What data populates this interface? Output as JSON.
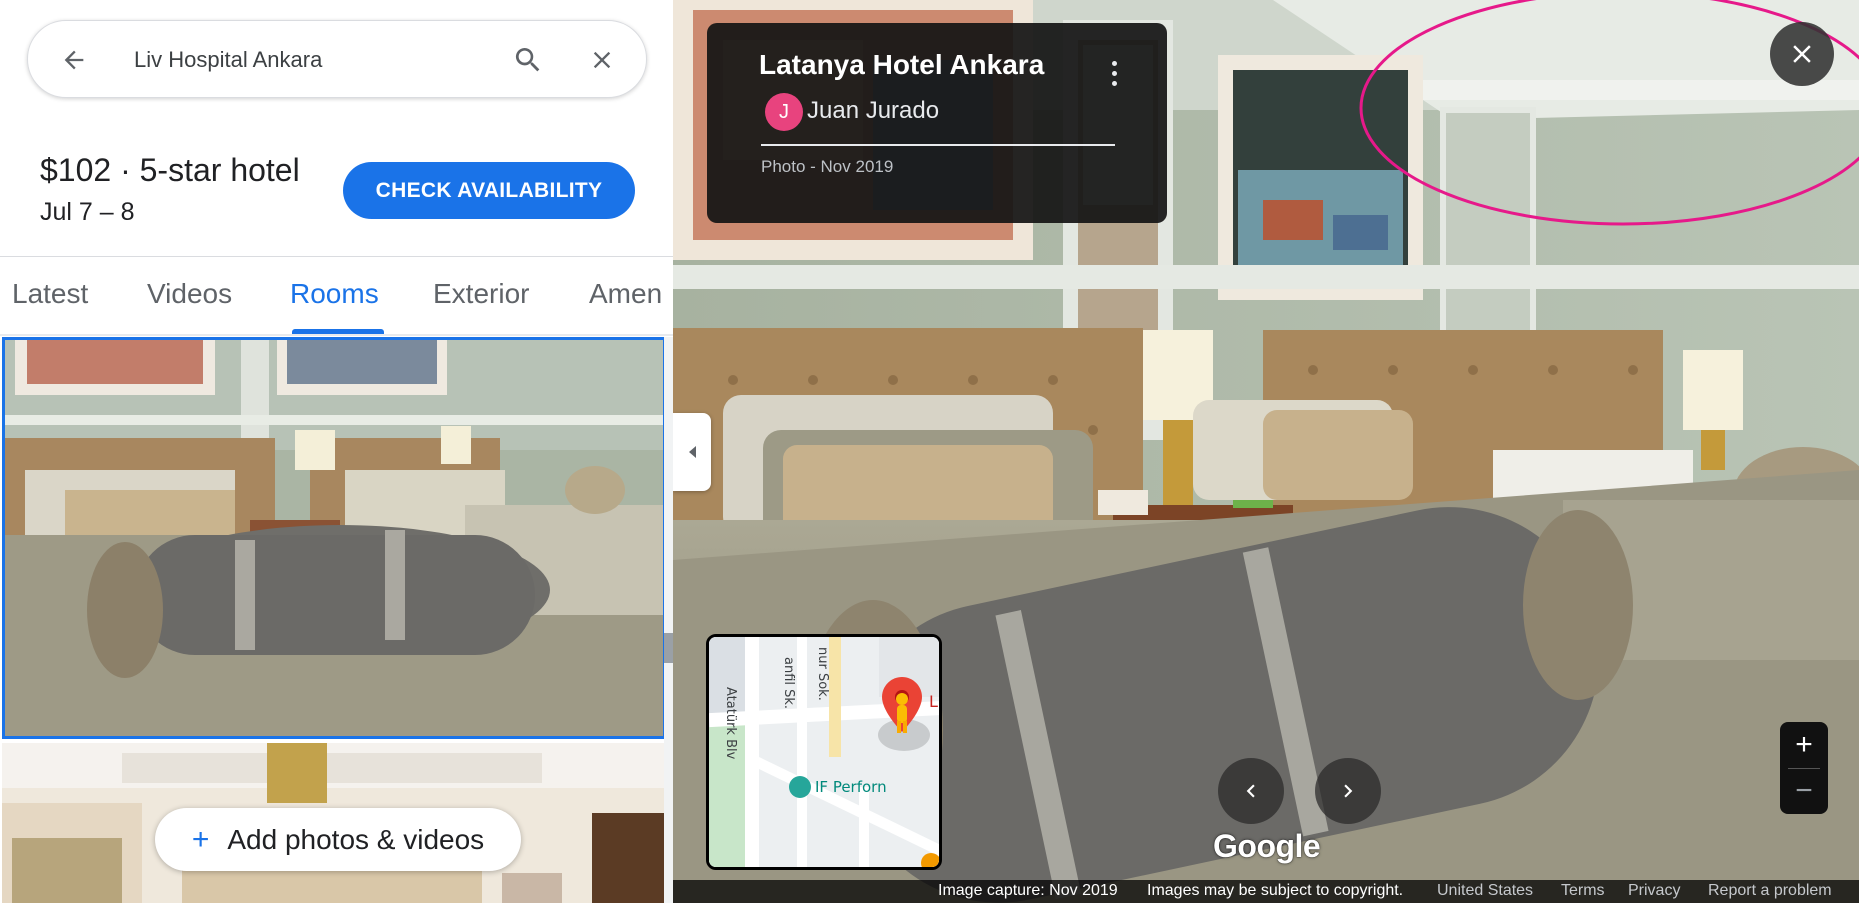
{
  "search": {
    "value": "Liv Hospital Ankara",
    "back_icon": "arrow-left-icon",
    "search_icon": "search-icon",
    "clear_icon": "close-icon"
  },
  "hotel_summary": {
    "price_line": "$102 · 5-star hotel",
    "dates": "Jul 7 – 8",
    "check_button": "CHECK AVAILABILITY"
  },
  "tabs": [
    {
      "label": "Latest",
      "active": false
    },
    {
      "label": "Videos",
      "active": false
    },
    {
      "label": "Rooms",
      "active": true
    },
    {
      "label": "Exterior",
      "active": false
    },
    {
      "label": "Amen",
      "active": false
    }
  ],
  "add_photos": {
    "label": "Add photos & videos"
  },
  "viewer": {
    "title": "Latanya Hotel Ankara",
    "author_initial": "J",
    "author": "Juan Jurado",
    "photo_date": "Photo - Nov 2019",
    "map_labels": {
      "street1": "Atatürk Blv",
      "street2": "anfil Sk.",
      "street3": "nur Sok.",
      "poi": "IF Perforn",
      "pin_letter": "L"
    },
    "google_logo": "Google",
    "zoom_in": "+",
    "zoom_out": "−"
  },
  "footer": {
    "capture": "Image capture: Nov 2019",
    "copyright": "Images may be subject to copyright.",
    "region": "United States",
    "terms": "Terms",
    "privacy": "Privacy",
    "report": "Report a problem"
  },
  "colors": {
    "accent": "#1a73e8",
    "avatar": "#e8437e",
    "highlight": "#e6198a"
  }
}
